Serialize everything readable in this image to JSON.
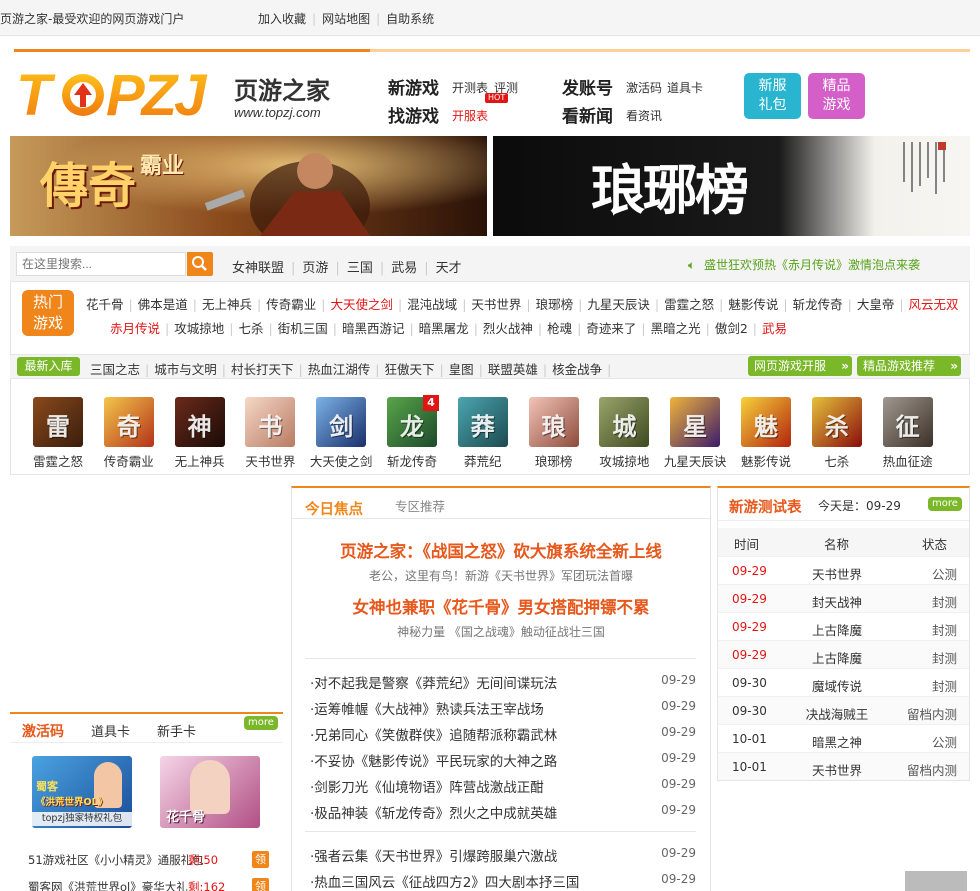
{
  "topbar": {
    "site_name": "页游之家-最受欢迎的网页游戏门户",
    "links": [
      "加入收藏",
      "网站地图",
      "自助系统"
    ]
  },
  "logo": {
    "brand": "TOPZJ",
    "cn": "页游之家",
    "url": "www.topzj.com"
  },
  "nav": {
    "xinyouxi": "新游戏",
    "xinyouxi_subs": [
      "开测表",
      "评测"
    ],
    "zhaoyouxi": "找游戏",
    "zhaoyouxi_sub": "开服表",
    "hot_tag": "HOT",
    "fazhanghao": "发账号",
    "fazhanghao_subs": [
      "激活码",
      "道具卡"
    ],
    "kanxinwen": "看新闻",
    "kanxinwen_sub": "看资讯",
    "btn1": "新服\n礼包",
    "btn2": "精品\n游戏"
  },
  "banners": {
    "left": {
      "title": "傳奇",
      "sub": "霸业"
    },
    "right": {
      "title": "琅琊榜"
    }
  },
  "search": {
    "placeholder": "在这里搜索..."
  },
  "quick_links": [
    "女神联盟",
    "页游",
    "三国",
    "武易",
    "天才"
  ],
  "notice": "盛世狂欢预热《赤月传说》激情泡点来袭",
  "hot": {
    "badge": "热门\n游戏",
    "row1": [
      {
        "t": "花千骨",
        "hot": false
      },
      {
        "t": "佛本是道",
        "hot": false
      },
      {
        "t": "无上神兵",
        "hot": false
      },
      {
        "t": "传奇霸业",
        "hot": false
      },
      {
        "t": "大天使之剑",
        "hot": true
      },
      {
        "t": "混沌战域",
        "hot": false
      },
      {
        "t": "天书世界",
        "hot": false
      },
      {
        "t": "琅琊榜",
        "hot": false
      },
      {
        "t": "九星天辰诀",
        "hot": false
      },
      {
        "t": "雷霆之怒",
        "hot": false
      },
      {
        "t": "魅影传说",
        "hot": false
      },
      {
        "t": "斩龙传奇",
        "hot": false
      },
      {
        "t": "大皇帝",
        "hot": false
      },
      {
        "t": "风云无双",
        "hot": true
      }
    ],
    "row2": [
      {
        "t": "赤月传说",
        "hot": true
      },
      {
        "t": "攻城掠地",
        "hot": false
      },
      {
        "t": "七杀",
        "hot": false
      },
      {
        "t": "街机三国",
        "hot": false
      },
      {
        "t": "暗黑西游记",
        "hot": false
      },
      {
        "t": "暗黑屠龙",
        "hot": false
      },
      {
        "t": "烈火战神",
        "hot": false
      },
      {
        "t": "枪魂",
        "hot": false
      },
      {
        "t": "奇迹来了",
        "hot": false
      },
      {
        "t": "黑暗之光",
        "hot": false
      },
      {
        "t": "傲剑2",
        "hot": false
      },
      {
        "t": "武易",
        "hot": true
      }
    ]
  },
  "newgames": {
    "badge": "最新入库",
    "links": [
      "三国之志",
      "城市与文明",
      "村长打天下",
      "热血江湖传",
      "狂傲天下",
      "皇图",
      "联盟英雄",
      "核金战争"
    ],
    "btn_open": "网页游戏开服",
    "btn_rec": "精品游戏推荐"
  },
  "icons": [
    {
      "name": "雷霆之怒",
      "c1": "#8a4a1c",
      "c2": "#3a1d0c",
      "glyph": "雷"
    },
    {
      "name": "传奇霸业",
      "c1": "#f4c64b",
      "c2": "#b3321a",
      "glyph": "奇"
    },
    {
      "name": "无上神兵",
      "c1": "#6b2a1a",
      "c2": "#1a0b07",
      "glyph": "神"
    },
    {
      "name": "天书世界",
      "c1": "#f5d8c7",
      "c2": "#b87a62",
      "glyph": "书"
    },
    {
      "name": "大天使之剑",
      "c1": "#7bb3e8",
      "c2": "#1a2f6b",
      "glyph": "剑"
    },
    {
      "name": "斩龙传奇",
      "c1": "#58a64a",
      "c2": "#1d4a2b",
      "glyph": "龙",
      "badge": "4"
    },
    {
      "name": "莽荒纪",
      "c1": "#4ba6b0",
      "c2": "#1d4a50",
      "glyph": "莽"
    },
    {
      "name": "琅琊榜",
      "c1": "#f2c4b8",
      "c2": "#8e4b3b",
      "glyph": "琅"
    },
    {
      "name": "攻城掠地",
      "c1": "#9aa56b",
      "c2": "#3d4a1f",
      "glyph": "城"
    },
    {
      "name": "九星天辰诀",
      "c1": "#f0b43a",
      "c2": "#3c1b6b",
      "glyph": "星"
    },
    {
      "name": "魅影传说",
      "c1": "#f6d23a",
      "c2": "#b3230e",
      "glyph": "魅"
    },
    {
      "name": "七杀",
      "c1": "#e5c23a",
      "c2": "#8a0d0d",
      "glyph": "杀"
    },
    {
      "name": "热血征途",
      "c1": "#a09890",
      "c2": "#3b3027",
      "glyph": "征"
    }
  ],
  "mid": {
    "tab_active": "今日焦点",
    "tab_inactive": "专区推荐",
    "headline1": "页游之家：《战国之怒》砍大旗系统全新上线",
    "sub1": "老公，这里有鸟！新游《天书世界》军团玩法首曝",
    "headline2": "女神也兼职《花千骨》男女搭配押镖不累",
    "sub2": "神秘力量 《国之战魂》触动征战壮三国",
    "news": [
      {
        "t": "·对不起我是警察《莽荒纪》无间间谍玩法",
        "d": "09-29"
      },
      {
        "t": "·运筹帷幄《大战神》熟读兵法王宰战场",
        "d": "09-29"
      },
      {
        "t": "·兄弟同心《笑傲群侠》追随帮派称霸武林",
        "d": "09-29"
      },
      {
        "t": "·不妥协《魅影传说》平民玩家的大神之路",
        "d": "09-29"
      },
      {
        "t": "·剑影刀光《仙境物语》阵营战激战正酣",
        "d": "09-29"
      },
      {
        "t": "·极品神装《斩龙传奇》烈火之中成就英雄",
        "d": "09-29"
      },
      {
        "t": "·强者云集《天书世界》引爆跨服巢穴激战",
        "d": "09-29"
      },
      {
        "t": "·热血三国风云《征战四方2》四大剧本抒三国",
        "d": "09-29"
      }
    ]
  },
  "test": {
    "title": "新游测试表",
    "today_label": "今天是：",
    "today": "09-29",
    "more": "more",
    "cols": [
      "时间",
      "名称",
      "状态"
    ],
    "rows": [
      {
        "d": "09-29",
        "n": "天书世界",
        "s": "公测",
        "today": true
      },
      {
        "d": "09-29",
        "n": "封天战神",
        "s": "封测",
        "today": true
      },
      {
        "d": "09-29",
        "n": "上古降魔",
        "s": "封测",
        "today": true
      },
      {
        "d": "09-29",
        "n": "上古降魔",
        "s": "封测",
        "today": true
      },
      {
        "d": "09-30",
        "n": "魔域传说",
        "s": "封测",
        "today": false
      },
      {
        "d": "09-30",
        "n": "决战海贼王",
        "s": "留档内测",
        "today": false
      },
      {
        "d": "10-01",
        "n": "暗黑之神",
        "s": "公测",
        "today": false
      },
      {
        "d": "10-01",
        "n": "天书世界",
        "s": "留档内测",
        "today": false
      }
    ]
  },
  "act": {
    "tab_active": "激活码",
    "tab2": "道具卡",
    "tab3": "新手卡",
    "more": "more",
    "card1_title": "《洪荒世界OL》",
    "card1_sub": "topzj独家特权礼包",
    "card1_logo": "蜀客",
    "card2_logo": "花千骨",
    "items": [
      {
        "t": "51游戏社区《小小精灵》通服礼包",
        "left_label": "剩:",
        "left": "50",
        "btn": "领"
      },
      {
        "t": "蜀客网《洪荒世界ol》豪华大礼",
        "left_label": "剩:",
        "left": "162",
        "btn": "领"
      }
    ]
  },
  "colors": {
    "accent": "#f08519",
    "green": "#7ab829",
    "red": "#e21515",
    "cyan": "#29b5cf",
    "pink": "#d55fc9"
  }
}
